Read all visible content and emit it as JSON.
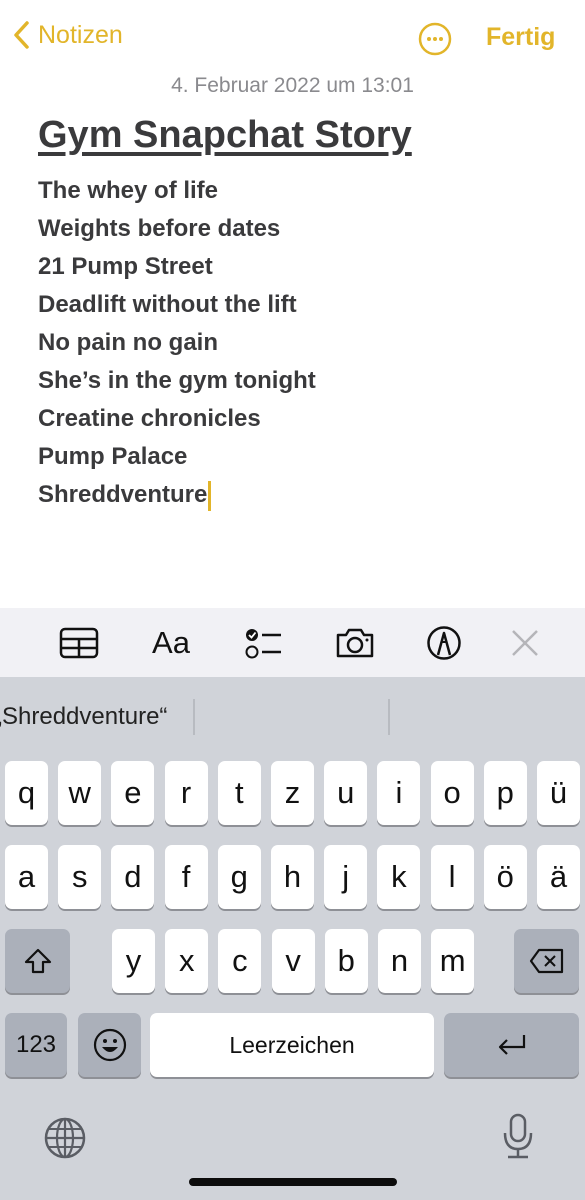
{
  "nav": {
    "back_label": "Notizen",
    "more_icon": "ellipsis-circle-icon",
    "done_label": "Fertig",
    "accent_color": "#e2b52a"
  },
  "note": {
    "date": "4. Februar 2022 um 13:01",
    "title": "Gym Snapchat Story",
    "lines": [
      "The whey of life",
      "Weights before dates",
      "21 Pump Street",
      "Deadlift without the lift",
      "No pain no gain",
      "She’s in the gym tonight",
      "Creatine chronicles",
      "Pump Palace",
      "Shreddventure"
    ]
  },
  "toolbar": {
    "icons": [
      "table-icon",
      "text-format-icon",
      "checklist-icon",
      "camera-icon",
      "markup-pen-icon",
      "close-icon"
    ],
    "format_label": "Aa"
  },
  "keyboard": {
    "suggestion": "„Shreddventure“",
    "row1": [
      "q",
      "w",
      "e",
      "r",
      "t",
      "z",
      "u",
      "i",
      "o",
      "p",
      "ü"
    ],
    "row2": [
      "a",
      "s",
      "d",
      "f",
      "g",
      "h",
      "j",
      "k",
      "l",
      "ö",
      "ä"
    ],
    "row3": [
      "y",
      "x",
      "c",
      "v",
      "b",
      "n",
      "m"
    ],
    "numbers_label": "123",
    "space_label": "Leerzeichen",
    "background_color": "#d0d3d9"
  }
}
